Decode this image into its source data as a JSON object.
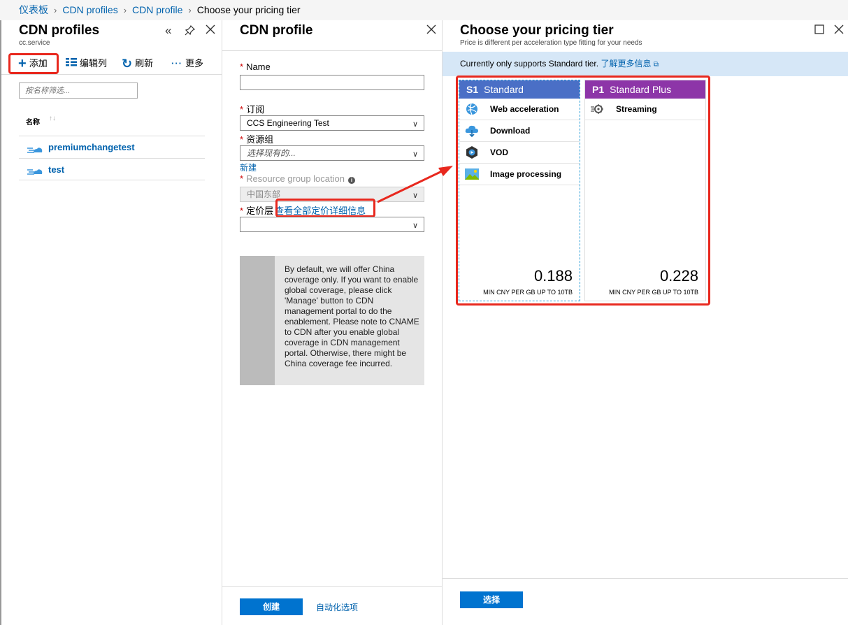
{
  "breadcrumb": [
    "仪表板",
    "CDN profiles",
    "CDN profile",
    "Choose your pricing tier"
  ],
  "profiles_blade": {
    "title": "CDN profiles",
    "subtitle": "cc.service",
    "toolbar": {
      "add": "添加",
      "edit_columns": "编辑列",
      "refresh": "刷新",
      "more": "更多"
    },
    "filter_placeholder": "按名称筛选...",
    "column_header": "名称",
    "rows": [
      "premiumchangetest",
      "test"
    ]
  },
  "profile_blade": {
    "title": "CDN profile",
    "name_label": "Name",
    "name_value": "",
    "subscription_label": "订阅",
    "subscription_value": "CCS Engineering Test",
    "resource_group_label": "资源组",
    "resource_group_placeholder": "选择现有的...",
    "create_new_link": "新建",
    "location_label": "Resource group location",
    "location_value": "中国东部",
    "pricing_label": "定价层",
    "pricing_link": "查看全部定价详细信息",
    "info_text": "By default, we will offer China coverage only. If you want to enable global coverage, please click 'Manage' button to CDN management portal to do the enablement. Please note to CNAME to CDN after you enable global coverage in CDN management portal. Otherwise, there might be China coverage fee incurred.",
    "create_button": "创建",
    "automation_link": "自动化选项"
  },
  "tier_blade": {
    "title": "Choose your pricing tier",
    "subtitle": "Price is different per acceleration type fitting for your needs",
    "notice_text": "Currently only supports Standard tier.",
    "notice_link": "了解更多信息",
    "select_button": "选择",
    "tiers": [
      {
        "code": "S1",
        "name": "Standard",
        "color": "#4a6fc6",
        "features": [
          "Web acceleration",
          "Download",
          "VOD",
          "Image processing"
        ],
        "price": "0.188",
        "unit": "MIN CNY PER GB UP TO 10TB",
        "selected": true
      },
      {
        "code": "P1",
        "name": "Standard Plus",
        "color": "#8d35a8",
        "features": [
          "Streaming"
        ],
        "price": "0.228",
        "unit": "MIN CNY PER GB UP TO 10TB",
        "selected": false
      }
    ]
  },
  "colors": {
    "accent": "#0062ad",
    "button": "#0073cf",
    "highlight": "#e8281e"
  }
}
